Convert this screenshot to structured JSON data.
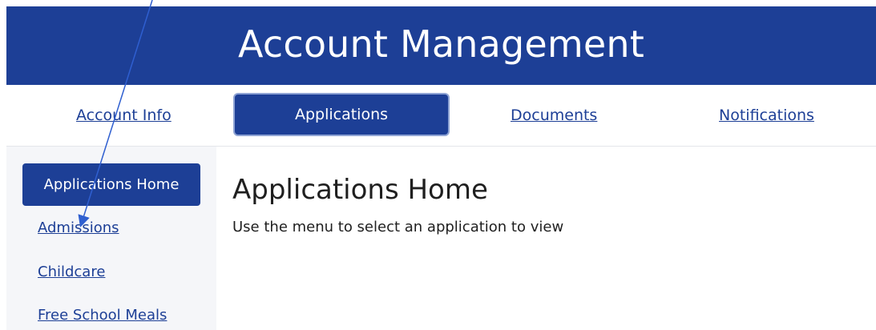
{
  "header": {
    "title": "Account Management"
  },
  "tabs": {
    "account_info": "Account Info",
    "applications": "Applications",
    "documents": "Documents",
    "notifications": "Notifications"
  },
  "sidebar": {
    "items": [
      {
        "label": "Applications Home",
        "active": true
      },
      {
        "label": "Admissions",
        "active": false
      },
      {
        "label": "Childcare",
        "active": false
      },
      {
        "label": "Free School Meals",
        "active": false
      }
    ]
  },
  "main": {
    "title": "Applications Home",
    "text": "Use the menu to select an application to view"
  },
  "colors": {
    "brand": "#1d3f96",
    "sidebar_bg": "#f5f6f9",
    "text": "#1f1f1f",
    "annotation_arrow": "#2f5fd0"
  }
}
